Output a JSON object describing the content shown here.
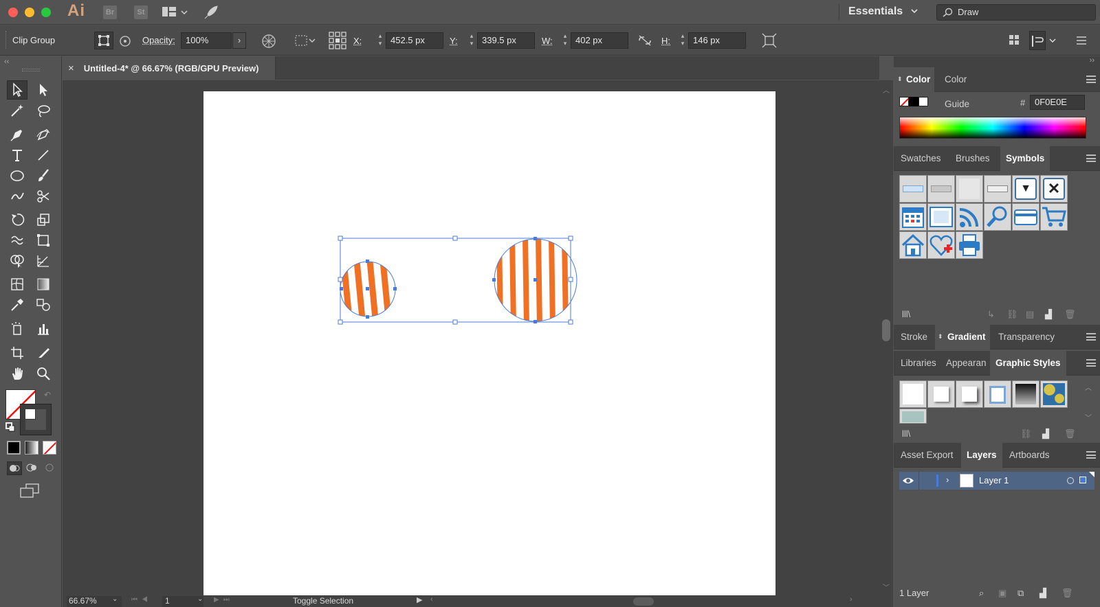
{
  "app": {
    "logo": "Ai",
    "br": "Br",
    "st": "St"
  },
  "titlebar": {
    "workspace": "Essentials",
    "search_value": "Draw"
  },
  "control": {
    "selection_type": "Clip Group",
    "opacity_label": "Opacity:",
    "opacity_value": "100%",
    "x_label": "X:",
    "x_value": "452.5 px",
    "y_label": "Y:",
    "y_value": "339.5 px",
    "w_label": "W:",
    "w_value": "402 px",
    "h_label": "H:",
    "h_value": "146 px"
  },
  "document": {
    "tab_title": "Untitled-4* @ 66.67% (RGB/GPU Preview)",
    "close": "×"
  },
  "status": {
    "zoom": "66.67%",
    "artboard": "1",
    "selection_info": "Toggle Selection"
  },
  "panels": {
    "color": {
      "tabs": [
        "Color",
        "Color Guide"
      ],
      "hex_label": "#",
      "hex_value": "0F0E0E"
    },
    "swatch_group": {
      "tabs": [
        "Swatches",
        "Brushes",
        "Symbols"
      ]
    },
    "stroke_group": {
      "tabs": [
        "Stroke",
        "Gradient",
        "Transparency"
      ]
    },
    "styles_group": {
      "tabs": [
        "Libraries",
        "Appearan",
        "Graphic Styles"
      ]
    },
    "layers_group": {
      "tabs": [
        "Asset Export",
        "Layers",
        "Artboards"
      ],
      "layer_name": "Layer 1",
      "footer": "1 Layer"
    }
  },
  "colors": {
    "accent": "#4a7bd8",
    "stripe": "#f07024",
    "panel": "#535353"
  }
}
